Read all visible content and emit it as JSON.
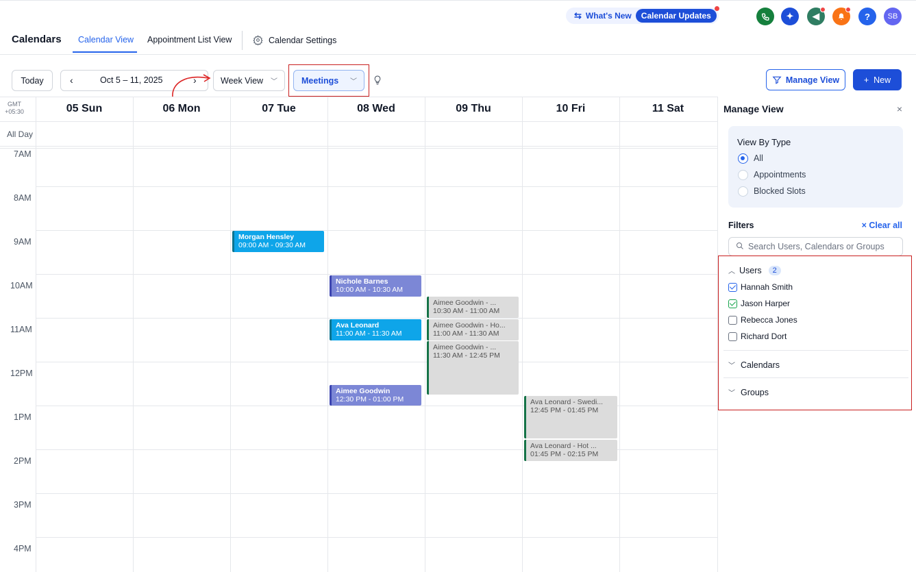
{
  "top": {
    "whats_new": "What's New",
    "calendar_updates": "Calendar Updates",
    "icons": [
      "phone-icon",
      "sparkle-icon",
      "megaphone-icon",
      "bell-icon",
      "help-icon"
    ],
    "avatar": "SB",
    "help": "?"
  },
  "nav": {
    "title": "Calendars",
    "tabs": [
      {
        "label": "Calendar View",
        "active": true
      },
      {
        "label": "Appointment List View",
        "active": false
      },
      {
        "label": "Calendar Settings",
        "active": false
      }
    ]
  },
  "toolbar": {
    "today": "Today",
    "prev": "‹",
    "range": "Oct 5 – 11, 2025",
    "next": "›",
    "view": "Week View",
    "filter": "Meetings",
    "manage_view": "Manage View",
    "new_label": "+  New"
  },
  "grid": {
    "tz": "GMT +05:30",
    "all_day": "All Day",
    "days": [
      "05 Sun",
      "06 Mon",
      "07 Tue",
      "08 Wed",
      "09 Thu",
      "10 Fri",
      "11 Sat"
    ],
    "hours": [
      "7AM",
      "8AM",
      "9AM",
      "10AM",
      "11AM",
      "12PM",
      "1PM",
      "2PM",
      "3PM",
      "4PM"
    ]
  },
  "events": [
    {
      "name": "Morgan Hensley",
      "time": "09:00 AM - 09:30 AM",
      "day": "07 Tue",
      "color": "#0ea5e9"
    },
    {
      "name": "Nichole Barnes",
      "time": "10:00 AM - 10:30 AM",
      "day": "08 Wed",
      "color": "#7c87d6"
    },
    {
      "name": "Ava Leonard",
      "time": "11:00 AM - 11:30 AM",
      "day": "08 Wed",
      "color": "#0ea5e9"
    },
    {
      "name": "Aimee Goodwin",
      "time": "12:30 PM - 01:00 PM",
      "day": "08 Wed",
      "color": "#7c87d6"
    },
    {
      "name": "Aimee Goodwin - ...",
      "time": "10:30 AM - 11:00 AM",
      "day": "09 Thu",
      "color": "#dcdcdc"
    },
    {
      "name": "Aimee Goodwin - Ho...",
      "time": "11:00 AM - 11:30 AM",
      "day": "09 Thu",
      "color": "#dcdcdc"
    },
    {
      "name": "Aimee Goodwin - ...",
      "time": "11:30 AM - 12:45 PM",
      "day": "09 Thu",
      "color": "#dcdcdc"
    },
    {
      "name": "Ava Leonard - Swedi...",
      "time": "12:45 PM - 01:45 PM",
      "day": "10 Fri",
      "color": "#dcdcdc"
    },
    {
      "name": "Ava Leonard - Hot ...",
      "time": "01:45 PM - 02:15 PM",
      "day": "10 Fri",
      "color": "#dcdcdc"
    }
  ],
  "panel": {
    "title": "Manage View",
    "close": "×",
    "view_by_type": "View By Type",
    "types": [
      {
        "label": "All",
        "selected": true
      },
      {
        "label": "Appointments",
        "selected": false
      },
      {
        "label": "Blocked Slots",
        "selected": false
      }
    ],
    "filters": "Filters",
    "clear_all": "× Clear all",
    "search_placeholder": "Search Users, Calendars or Groups",
    "users_label": "Users",
    "users_count": "2",
    "users": [
      {
        "name": "Hannah Smith",
        "checked": true
      },
      {
        "name": "Jason Harper",
        "checked": true
      },
      {
        "name": "Rebecca Jones",
        "checked": false
      },
      {
        "name": "Richard Dort",
        "checked": false
      }
    ],
    "calendars_label": "Calendars",
    "groups_label": "Groups"
  },
  "colors": {
    "accent": "#2563eb",
    "highlight_box": "#c81e1e"
  }
}
